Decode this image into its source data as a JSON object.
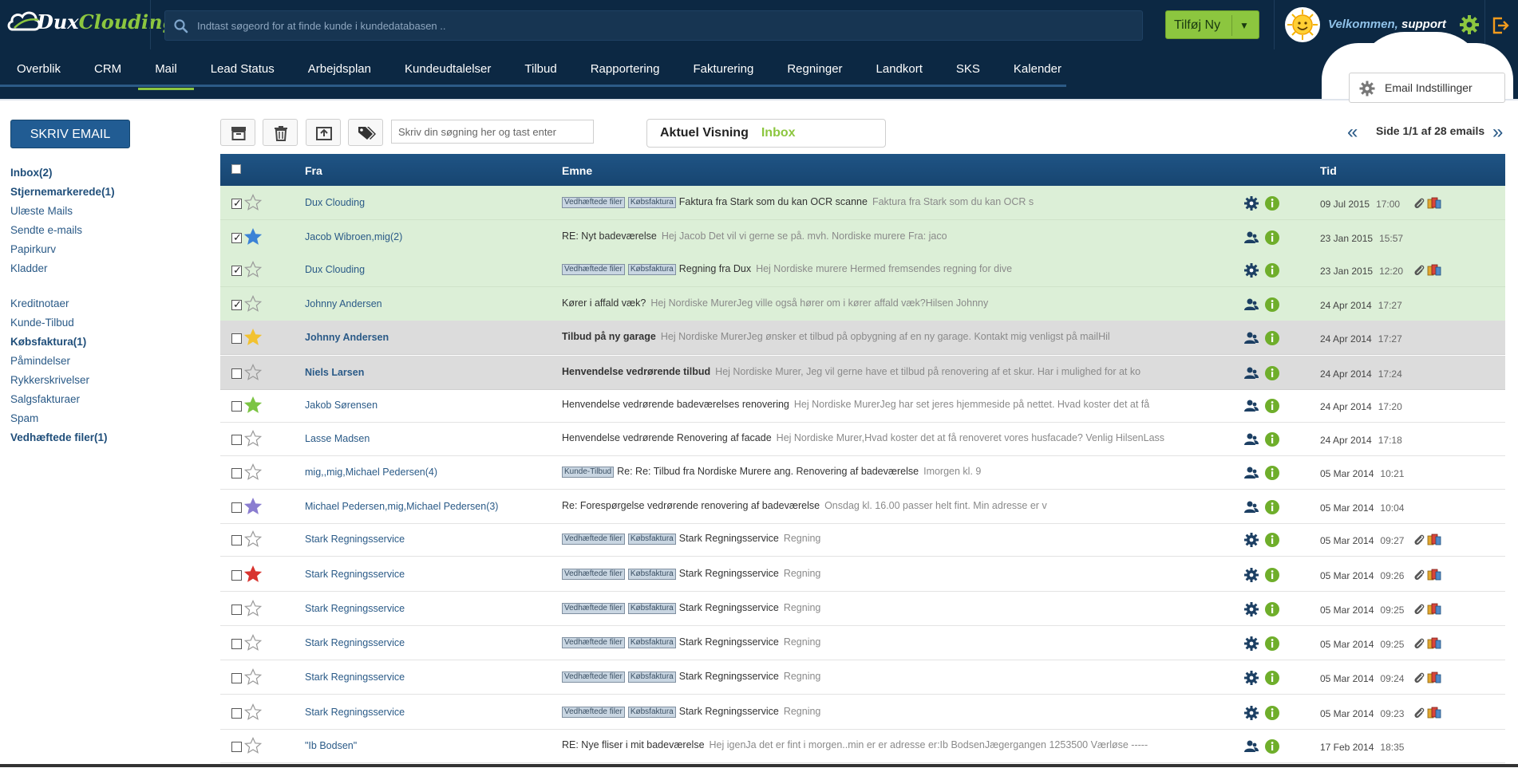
{
  "brand": {
    "name_a": "Dux",
    "name_b": "Clouding"
  },
  "search": {
    "placeholder": "Indtast søgeord for at finde kunde i kundedatabasen .."
  },
  "header": {
    "add_label": "Tilføj Ny",
    "welcome": "Velkommen,",
    "user": "support"
  },
  "nav": [
    {
      "label": "Overblik"
    },
    {
      "label": "CRM"
    },
    {
      "label": "Mail",
      "active": true
    },
    {
      "label": "Lead Status"
    },
    {
      "label": "Arbejdsplan"
    },
    {
      "label": "Kundeudtalelser"
    },
    {
      "label": "Tilbud"
    },
    {
      "label": "Rapportering"
    },
    {
      "label": "Fakturering"
    },
    {
      "label": "Regninger"
    },
    {
      "label": "Landkort"
    },
    {
      "label": "SKS"
    },
    {
      "label": "Kalender"
    }
  ],
  "email_settings_label": "Email Indstillinger",
  "compose_label": "SKRIV EMAIL",
  "folders_a": [
    {
      "label": "Inbox(2)",
      "bold": true
    },
    {
      "label": "Stjernemarkerede(1)",
      "bold": true
    },
    {
      "label": "Ulæste Mails"
    },
    {
      "label": "Sendte e-mails"
    },
    {
      "label": "Papirkurv"
    },
    {
      "label": "Kladder"
    }
  ],
  "folders_b": [
    {
      "label": "Kreditnotaer"
    },
    {
      "label": "Kunde-Tilbud"
    },
    {
      "label": "Købsfaktura(1)",
      "bold": true
    },
    {
      "label": "Påmindelser"
    },
    {
      "label": "Rykkerskrivelser"
    },
    {
      "label": "Salgsfakturaer"
    },
    {
      "label": "Spam"
    },
    {
      "label": "Vedhæftede filer(1)",
      "bold": true
    }
  ],
  "toolbar": {
    "filter_placeholder": "Skriv din søgning her og tast enter",
    "view_label": "Aktuel Visning",
    "view_value": "Inbox",
    "pager": "Side 1/1 af 28 emails",
    "prev_icon": "double-chevron-left-icon",
    "next_icon": "double-chevron-right-icon"
  },
  "table": {
    "headers": {
      "from": "Fra",
      "subject": "Emne",
      "time": "Tid"
    },
    "rows": [
      {
        "style": "green",
        "checked": true,
        "star": "none",
        "from": "Dux Clouding",
        "tags": [
          "Vedhæftede filer",
          "Købsfaktura"
        ],
        "subject": "Faktura fra Stark som du kan OCR scanne",
        "preview": "Faktura fra Stark som du kan OCR s",
        "icon": "gear",
        "date": "09 Jul 2015",
        "time": "17:00",
        "attach": true
      },
      {
        "style": "green",
        "checked": true,
        "star": "blue",
        "from": "Jacob Wibroen,mig(2)",
        "tags": [],
        "subject": "RE: Nyt badeværelse",
        "preview": "Hej Jacob   Det vil vi gerne se på.   mvh. Nordiske murere   Fra: jaco",
        "icon": "user",
        "date": "23 Jan 2015",
        "time": "15:57",
        "attach": false
      },
      {
        "style": "green",
        "checked": true,
        "star": "none",
        "from": "Dux Clouding",
        "tags": [
          "Vedhæftede filer",
          "Købsfaktura"
        ],
        "subject": "Regning fra Dux",
        "preview": "Hej Nordiske murere   Hermed fremsendes regning for dive",
        "icon": "gear",
        "date": "23 Jan 2015",
        "time": "12:20",
        "attach": true
      },
      {
        "style": "green",
        "checked": true,
        "star": "none",
        "from": "Johnny Andersen",
        "tags": [],
        "subject": "Kører i affald væk?",
        "preview": "Hej Nordiske MurerJeg ville også hører om i kører affald væk?Hilsen Johnny",
        "icon": "user",
        "date": "24 Apr 2014",
        "time": "17:27",
        "attach": false
      },
      {
        "style": "grey",
        "unread": true,
        "checked": false,
        "star": "yellow",
        "from": "Johnny Andersen",
        "tags": [],
        "subject": "Tilbud på ny garage",
        "preview": "Hej Nordiske MurerJeg ønsker et tilbud på opbygning af en ny garage. Kontakt mig venligst på mailHil",
        "icon": "user",
        "date": "24 Apr 2014",
        "time": "17:27",
        "attach": false
      },
      {
        "style": "grey",
        "unread": true,
        "checked": false,
        "star": "none",
        "from": "Niels Larsen",
        "tags": [],
        "subject": "Henvendelse vedrørende tilbud",
        "preview": "Hej Nordiske Murer, Jeg vil gerne have et tilbud på renovering af et skur. Har i mulighed for at ko",
        "icon": "user",
        "date": "24 Apr 2014",
        "time": "17:24",
        "attach": false
      },
      {
        "style": "white",
        "checked": false,
        "star": "green",
        "from": "Jakob Sørensen",
        "tags": [],
        "subject": "Henvendelse vedrørende badeværelses renovering",
        "preview": "Hej Nordiske MurerJeg har set jeres hjemmeside på nettet. Hvad koster det at få",
        "icon": "user",
        "date": "24 Apr 2014",
        "time": "17:20",
        "attach": false
      },
      {
        "style": "white",
        "checked": false,
        "star": "none",
        "from": "Lasse Madsen",
        "tags": [],
        "subject": "Henvendelse vedrørende Renovering af facade",
        "preview": "Hej Nordiske Murer,Hvad koster det at få renoveret vores husfacade? Venlig HilsenLass",
        "icon": "user",
        "date": "24 Apr 2014",
        "time": "17:18",
        "attach": false
      },
      {
        "style": "white",
        "checked": false,
        "star": "none",
        "from": "mig,,mig,Michael Pedersen(4)",
        "tags": [
          "Kunde-Tilbud"
        ],
        "subject": "Re: Re: Tilbud fra Nordiske Murere ang. Renovering af badeværelse",
        "preview": "Imorgen kl. 9",
        "icon": "user",
        "date": "05 Mar 2014",
        "time": "10:21",
        "attach": false
      },
      {
        "style": "white",
        "checked": false,
        "star": "purple",
        "from": "Michael Pedersen,mig,Michael Pedersen(3)",
        "tags": [],
        "subject": "Re: Forespørgelse vedrørende renovering af badeværelse",
        "preview": "Onsdag kl. 16.00 passer helt fint. Min adresse er v",
        "icon": "user",
        "date": "05 Mar 2014",
        "time": "10:04",
        "attach": false
      },
      {
        "style": "white",
        "checked": false,
        "star": "none",
        "from": "Stark Regningsservice",
        "tags": [
          "Vedhæftede filer",
          "Købsfaktura"
        ],
        "subject": "Stark Regningsservice",
        "preview": "Regning",
        "icon": "gear",
        "date": "05 Mar 2014",
        "time": "09:27",
        "attach": true
      },
      {
        "style": "white",
        "checked": false,
        "star": "red",
        "from": "Stark Regningsservice",
        "tags": [
          "Vedhæftede filer",
          "Købsfaktura"
        ],
        "subject": "Stark Regningsservice",
        "preview": "Regning",
        "icon": "gear",
        "date": "05 Mar 2014",
        "time": "09:26",
        "attach": true
      },
      {
        "style": "white",
        "checked": false,
        "star": "none",
        "from": "Stark Regningsservice",
        "tags": [
          "Vedhæftede filer",
          "Købsfaktura"
        ],
        "subject": "Stark Regningsservice",
        "preview": "Regning",
        "icon": "gear",
        "date": "05 Mar 2014",
        "time": "09:25",
        "attach": true
      },
      {
        "style": "white",
        "checked": false,
        "star": "none",
        "from": "Stark Regningsservice",
        "tags": [
          "Vedhæftede filer",
          "Købsfaktura"
        ],
        "subject": "Stark Regningsservice",
        "preview": "Regning",
        "icon": "gear",
        "date": "05 Mar 2014",
        "time": "09:25",
        "attach": true
      },
      {
        "style": "white",
        "checked": false,
        "star": "none",
        "from": "Stark Regningsservice",
        "tags": [
          "Vedhæftede filer",
          "Købsfaktura"
        ],
        "subject": "Stark Regningsservice",
        "preview": "Regning",
        "icon": "gear",
        "date": "05 Mar 2014",
        "time": "09:24",
        "attach": true
      },
      {
        "style": "white",
        "checked": false,
        "star": "none",
        "from": "Stark Regningsservice",
        "tags": [
          "Vedhæftede filer",
          "Købsfaktura"
        ],
        "subject": "Stark Regningsservice",
        "preview": "Regning",
        "icon": "gear",
        "date": "05 Mar 2014",
        "time": "09:23",
        "attach": true
      },
      {
        "style": "white",
        "checked": false,
        "star": "none",
        "from": "\"Ib Bodsen\"",
        "tags": [],
        "subject": "RE: Nye fliser i mit badeværelse",
        "preview": "Hej igenJa det er fint i morgen..min er er adresse er:Ib BodsenJægergangen 1253500 Værløse -----",
        "icon": "user",
        "date": "17 Feb 2014",
        "time": "18:35",
        "attach": false
      }
    ]
  },
  "colors": {
    "header_bg": "#0c2843",
    "accent_green": "#8cc63f",
    "table_header": "#1c4f7f",
    "row_green": "#dcefd7",
    "row_grey": "#dcdcdc",
    "star_blue": "#3b82d6",
    "star_yellow": "#f2c230",
    "star_green": "#7cc444",
    "star_purple": "#8a7dd0",
    "star_red": "#d8342f"
  }
}
